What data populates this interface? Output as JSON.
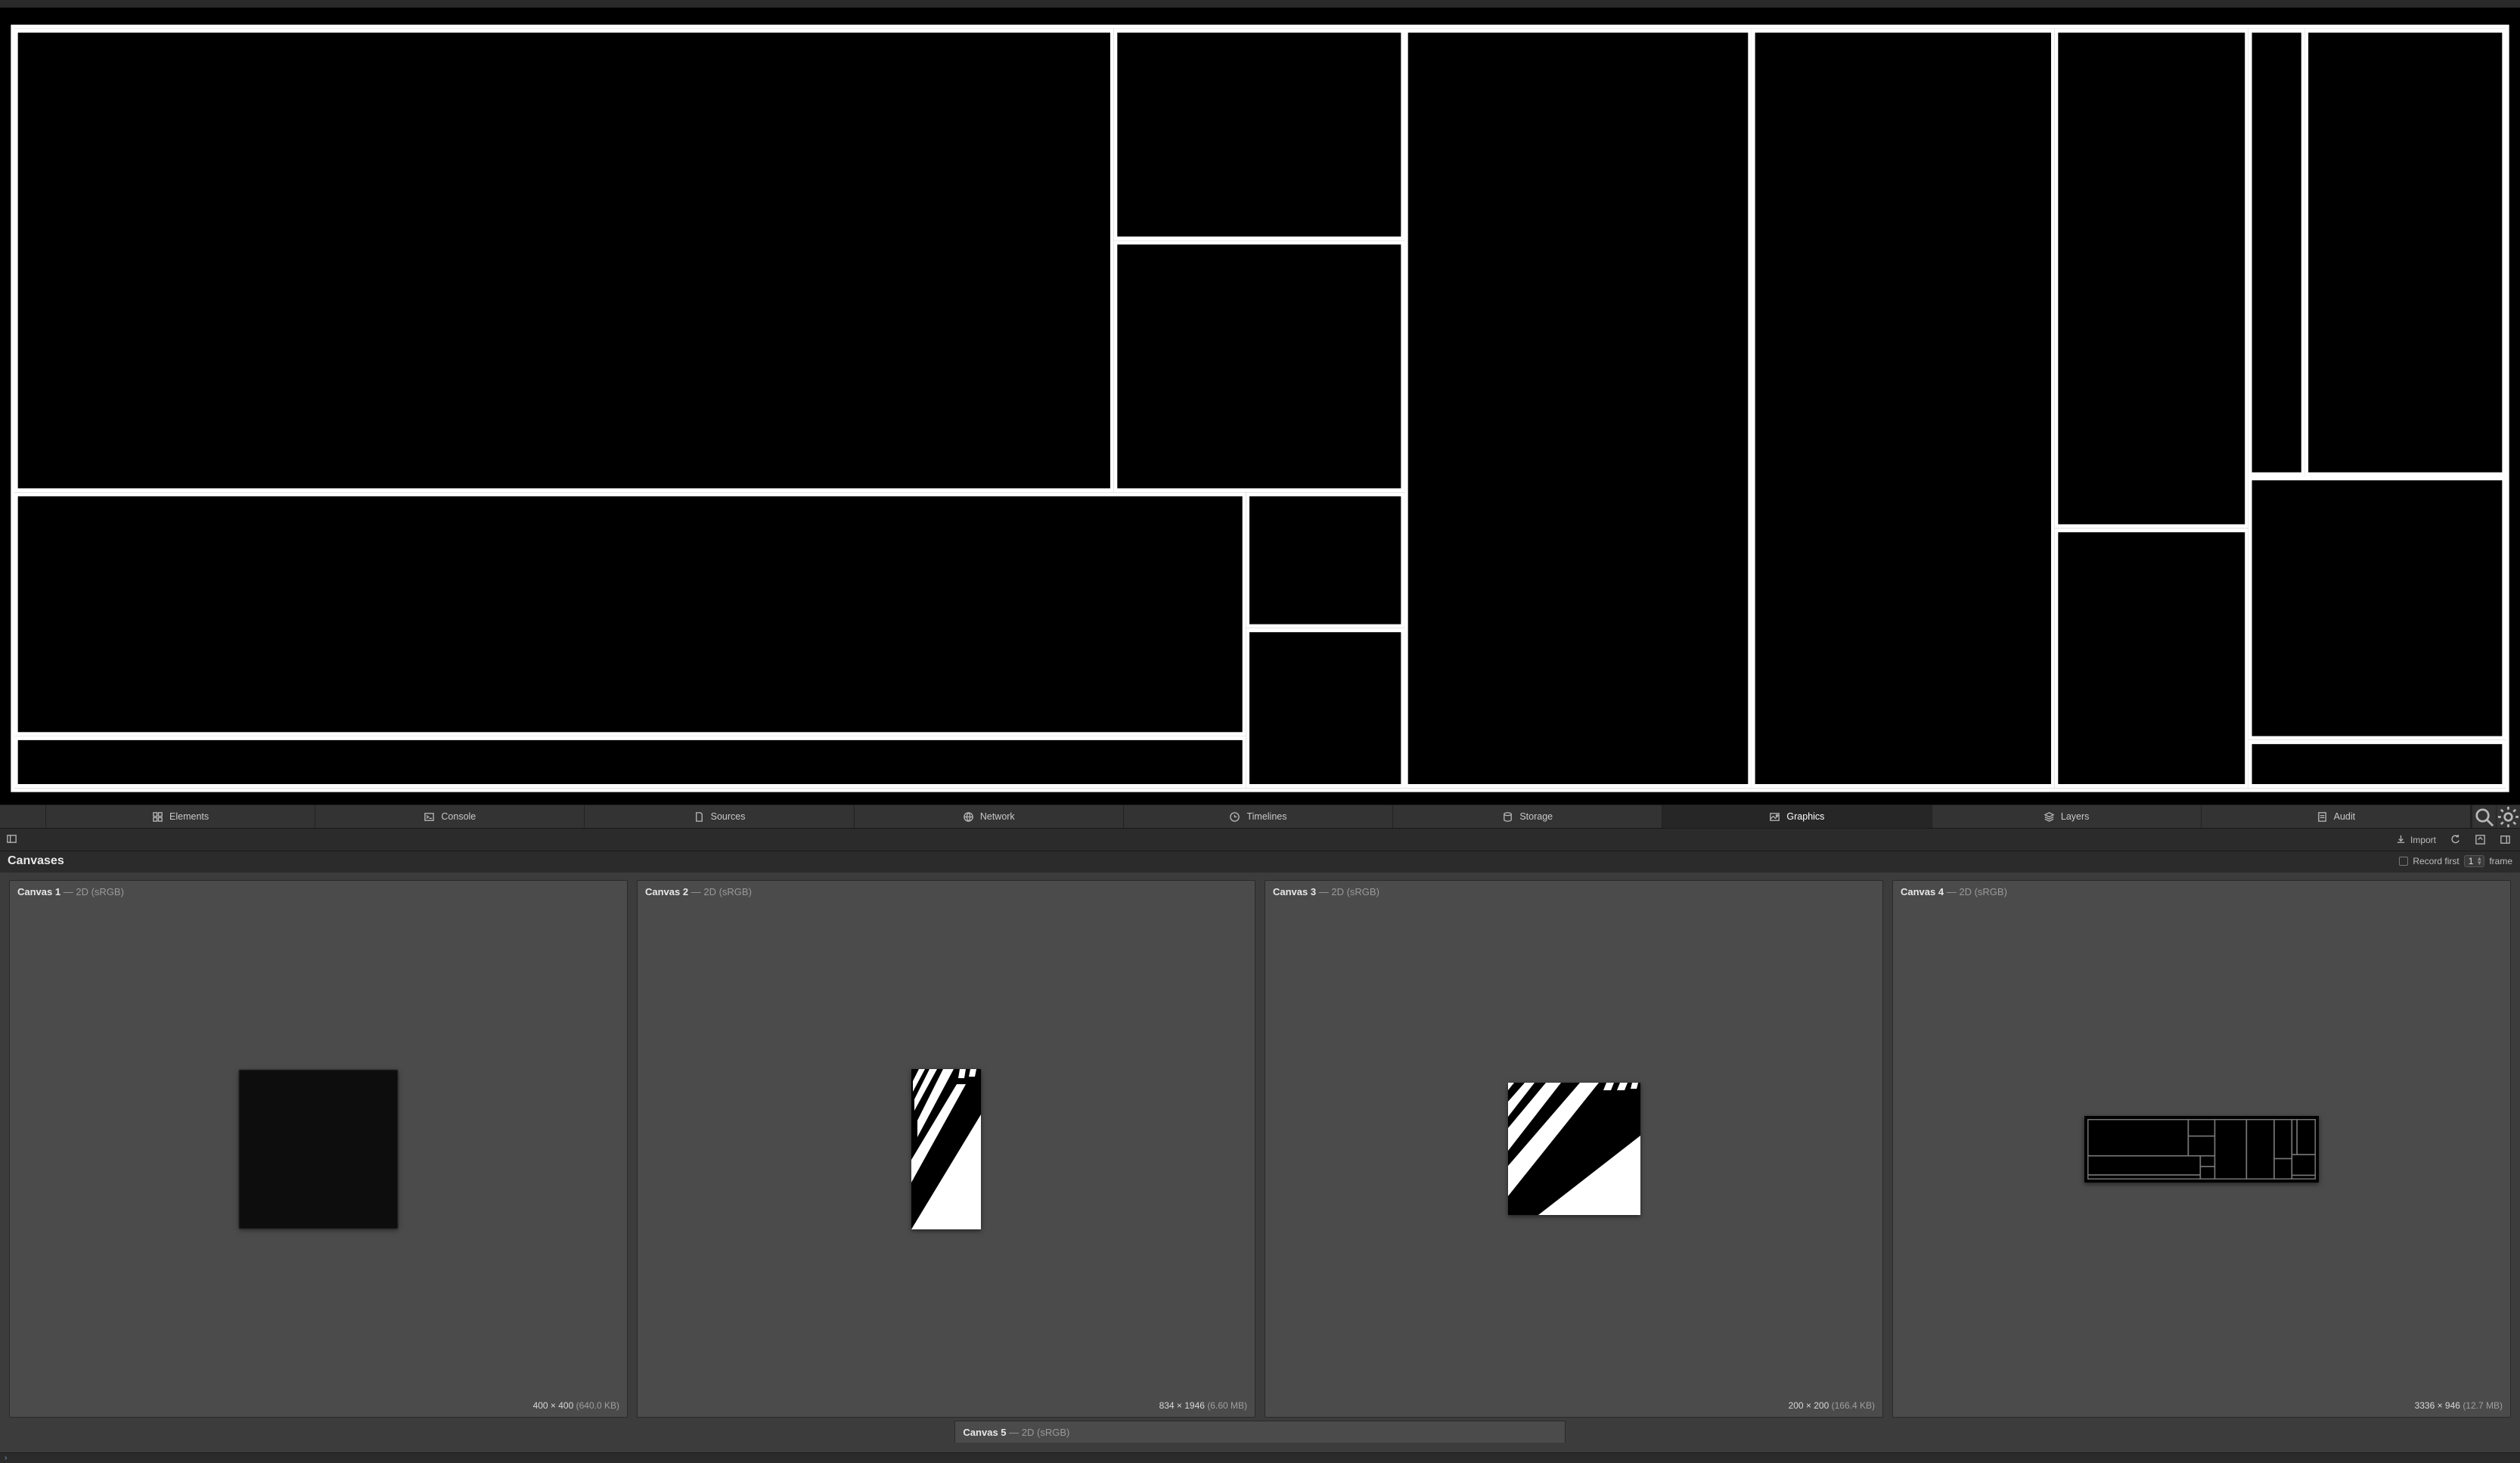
{
  "tabs": {
    "elements": "Elements",
    "console": "Console",
    "sources": "Sources",
    "network": "Network",
    "timelines": "Timelines",
    "storage": "Storage",
    "graphics": "Graphics",
    "layers": "Layers",
    "audit": "Audit"
  },
  "toolbar": {
    "import": "Import"
  },
  "canvases": {
    "title": "Canvases",
    "record_first_label": "Record first",
    "record_first_value": "1",
    "record_unit": "frame"
  },
  "tiles": [
    {
      "name": "Canvas 1",
      "ctx": "2D (sRGB)",
      "dims": "400 × 400",
      "size": "(640.0 KB)"
    },
    {
      "name": "Canvas 2",
      "ctx": "2D (sRGB)",
      "dims": "834 × 1946",
      "size": "(6.60 MB)"
    },
    {
      "name": "Canvas 3",
      "ctx": "2D (sRGB)",
      "dims": "200 × 200",
      "size": "(166.4 KB)"
    },
    {
      "name": "Canvas 4",
      "ctx": "2D (sRGB)",
      "dims": "3336 × 946",
      "size": "(12.7 MB)"
    }
  ],
  "tile5": {
    "name": "Canvas 5",
    "ctx": "2D (sRGB)"
  },
  "active_tab": "graphics"
}
